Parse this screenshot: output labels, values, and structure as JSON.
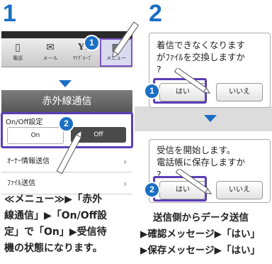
{
  "step1": {
    "number": "1",
    "tabs": [
      {
        "label": "電話",
        "icon": "phone-icon",
        "glyph": "▯"
      },
      {
        "label": "メール",
        "icon": "mail-icon",
        "glyph": "✉"
      },
      {
        "label": "Y!ｸﾞﾙｰﾌﾞ",
        "icon": "yahoo-icon",
        "glyph": "Y!"
      },
      {
        "label": "メニュー",
        "icon": "menu-grid-icon",
        "glyph": "▦"
      }
    ],
    "page_title": "赤外線通信",
    "setting_label": "On/Off設定",
    "on_button": "On",
    "off_button": "Off",
    "list_items": [
      "ｵｰﾅｰ情報送信",
      "ﾌｧｲﾙ送信"
    ],
    "caption": [
      "≪メニュー≫▶「赤外",
      "線通信」▶「On/Off設",
      "定」で「On」▶受信待",
      "機の状態になります。"
    ]
  },
  "step2": {
    "number": "2",
    "dialog1": {
      "text": [
        "着信できなくなります",
        "がﾌｧｲﾙを交換しますか",
        "?"
      ],
      "yes": "はい",
      "no": "いいえ"
    },
    "dialog2": {
      "text": [
        "受信を開始します。",
        "電話帳に保存しますか",
        "?"
      ],
      "yes": "はい",
      "no": "いいえ"
    },
    "caption": [
      "送信側からデータ送信",
      "▶確認メッセージ▶「はい」",
      "▶保存メッセージ▶「はい」"
    ]
  },
  "badges": {
    "one": "1",
    "two": "2"
  },
  "colors": {
    "accent": "#1a6fc4",
    "highlight": "#5b3fb8",
    "band": "#dcdcdc"
  }
}
